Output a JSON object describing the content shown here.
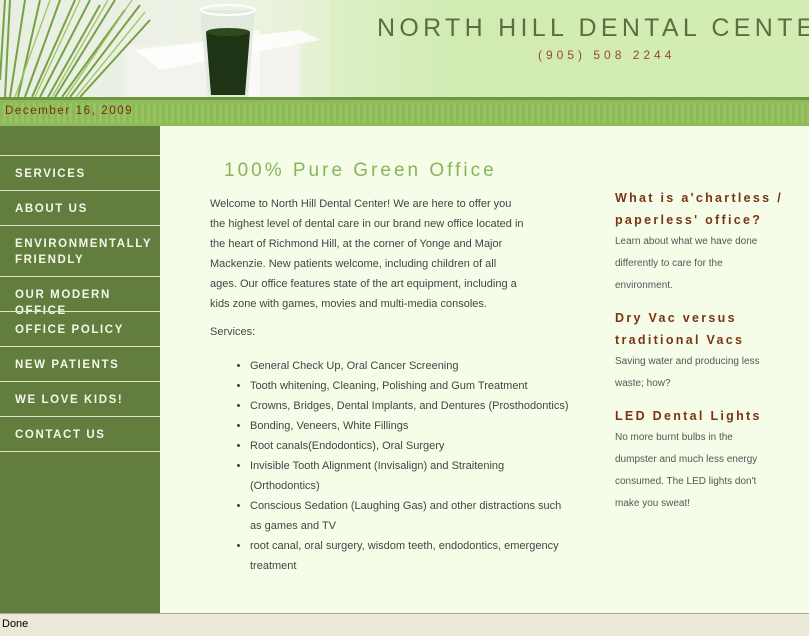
{
  "header": {
    "title": "NORTH HILL DENTAL CENTE",
    "phone": "(905) 508 2244"
  },
  "date": "December 16, 2009",
  "nav": [
    "SERVICES",
    "ABOUT US",
    "ENVIRONMENTALLY FRIENDLY",
    "OUR MODERN OFFICE",
    "OFFICE POLICY",
    "NEW PATIENTS",
    "WE LOVE KIDS!",
    "CONTACT US"
  ],
  "main": {
    "heading": "100% Pure Green Office",
    "intro": "Welcome to North Hill Dental Center!  We are here to offer you the highest level of dental care in our brand new office located in the heart of Richmond Hill, at the corner of Yonge and Major Mackenzie. New patients welcome, including children of all ages.  Our office features state of the art equipment, including a kids zone with games, movies and multi-media consoles.",
    "services_label": "Services:",
    "services": [
      "General Check Up, Oral Cancer Screening",
      "Tooth whitening, Cleaning, Polishing and Gum Treatment",
      "Crowns, Bridges, Dental Implants, and Dentures (Prosthodontics)",
      "Bonding, Veneers, White Fillings",
      "Root canals(Endodontics), Oral Surgery",
      "Invisible Tooth Alignment (Invisalign) and Straitening (Orthodontics)",
      "Conscious Sedation (Laughing Gas) and other distractions such as games and TV",
      "root canal, oral surgery, wisdom teeth, endodontics, emergency treatment"
    ]
  },
  "sidebar_right": [
    {
      "heading": "What is a'chartless / paperless' office?",
      "text": "Learn about what we have done differently to care for the environment."
    },
    {
      "heading": "Dry Vac versus traditional Vacs",
      "text": "Saving water and producing less waste; how?"
    },
    {
      "heading": "LED Dental Lights",
      "text": "No more burnt bulbs in the dumpster and much less energy consumed. The LED lights don't make you sweat!"
    }
  ],
  "status": "Done"
}
